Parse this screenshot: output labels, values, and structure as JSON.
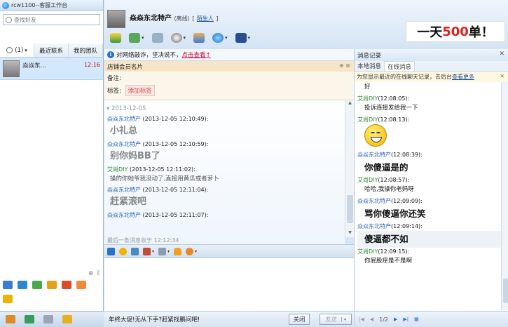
{
  "window": {
    "title": "rcw1100--客服工作台"
  },
  "search": {
    "placeholder": "查找好友"
  },
  "left_tabs": [
    {
      "label": "(1)",
      "dropdown": "▾"
    },
    {
      "label": "最近联系"
    },
    {
      "label": "我的团队"
    }
  ],
  "contact": {
    "name": "焱焱东...",
    "time": "12:16"
  },
  "chat_header": {
    "name": "焱焱东北特产",
    "status": "(离线)",
    "relation_open": "[",
    "relation": "陌生人",
    "relation_close": "]"
  },
  "ad": {
    "prefix": "一天",
    "number": "500",
    "suffix": "单！"
  },
  "notice": {
    "text": "对网络敲诈，坚决说不，",
    "link": "点击查看↑"
  },
  "card": {
    "title": "店铺会员名片",
    "note_label": "备注:",
    "tag_label": "标签:",
    "add_tag_button": "添加标签"
  },
  "chat": {
    "date": "2013-12-05",
    "messages": [
      {
        "sender": "焱焱东北特产",
        "time": "(2013-12-05 12:10:49):",
        "text": "小礼总",
        "style": "big",
        "color": "blue"
      },
      {
        "sender": "焱焱东北特产",
        "time": "(2013-12-05 12:10:59):",
        "text": "别你妈BB了",
        "style": "big",
        "color": "blue"
      },
      {
        "sender": "艾尚DIY",
        "time": "(2013-12-05 12:11:02):",
        "text": "操的你她爷我没动了,直接用黄瓜或者萝卜",
        "style": "small",
        "color": "green"
      },
      {
        "sender": "焱焱东北特产",
        "time": "(2013-12-05 12:11:04):",
        "text": "赶紧滚吧",
        "style": "big",
        "color": "blue"
      },
      {
        "sender": "焱焱东北特产",
        "time": "(2013-12-05 12:11:07):",
        "text": "",
        "style": "small",
        "color": "blue"
      }
    ],
    "last_message": "最后一条消息收于 12:12:34"
  },
  "send_bar": {
    "tip": "年终大促!无从下手?赶紧找鹏问吧!",
    "close_button": "关闭",
    "send_button": "发送",
    "send_dropdown": "▾"
  },
  "history": {
    "title": "消息记录",
    "tabs": [
      "本地消息",
      "在线消息"
    ],
    "note": "为您显示最近的在线聊天记录，去后台",
    "note_link": "查看更多",
    "items": [
      {
        "sender": "",
        "time": "",
        "text": "好",
        "type": "text"
      },
      {
        "sender": "艾尚DIY",
        "time": "(12:08:05):",
        "text": "投诉连接发给我一下",
        "type": "text",
        "color": "green"
      },
      {
        "sender": "艾尚DIY",
        "time": "(12:08:13):",
        "text": "",
        "type": "emoji",
        "color": "green"
      },
      {
        "sender": "焱焱东北特产",
        "time": "(12:08:39):",
        "text": "你傻逼是的",
        "type": "big",
        "color": "blue"
      },
      {
        "sender": "艾尚DIY",
        "time": "(12:08:57):",
        "text": "哈哈,我操你老妈呀",
        "type": "text",
        "color": "green"
      },
      {
        "sender": "焱焱东北特产",
        "time": "(12:09:09):",
        "text": "骂你傻逼你还笑",
        "type": "big",
        "color": "blue"
      },
      {
        "sender": "焱焱东北特产",
        "time": "(12:09:14):",
        "text": "傻逼都不如",
        "type": "big-hl",
        "color": "blue"
      },
      {
        "sender": "艾尚DIY",
        "time": "(12:09:15):",
        "text": "你屁股痒是不是啊",
        "type": "text",
        "color": "green"
      }
    ],
    "pager": "1/2"
  },
  "icons": {
    "toolbar": [
      "transfer-icon",
      "folder-icon",
      "signal-icon",
      "camera-icon",
      "person-icon",
      "globe-icon",
      "hat-icon"
    ],
    "format": [
      "font-icon",
      "emoji-icon",
      "image-icon",
      "screenshot-icon",
      "file-icon",
      "bell-icon",
      "heart-icon"
    ],
    "apps": [
      "user-icon",
      "store-icon",
      "app-icon",
      "box-icon",
      "shop-icon",
      "bag-icon",
      "flag-icon"
    ],
    "bottom": [
      "chat-icon",
      "phone-icon",
      "contacts-icon",
      "message-icon"
    ]
  }
}
